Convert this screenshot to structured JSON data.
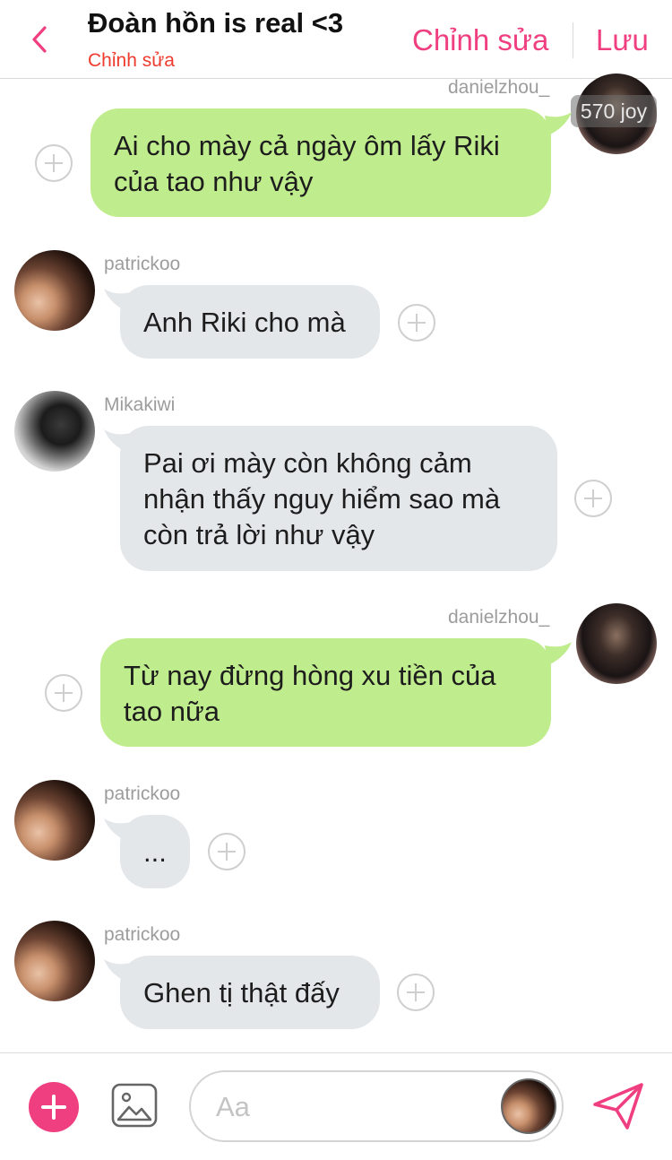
{
  "header": {
    "title": "Đoàn hồn is real <3",
    "subtitle": "Chỉnh sửa",
    "edit_label": "Chỉnh sửa",
    "save_label": "Lưu"
  },
  "messages": [
    {
      "user": "danielzhou_",
      "side": "right",
      "lines": [
        "Ai cho mày cả ngày ôm lấy Riki",
        "của tao như vậy"
      ],
      "badge": "570 joy"
    },
    {
      "user": "patrickoo",
      "side": "left",
      "lines": [
        "Anh Riki cho mà"
      ]
    },
    {
      "user": "Mikakiwi",
      "side": "left",
      "lines": [
        "Pai ơi mày còn không cảm",
        "nhận thấy nguy hiểm sao mà",
        "còn trả lời như vậy"
      ]
    },
    {
      "user": "danielzhou_",
      "side": "right",
      "lines": [
        "Từ nay đừng hòng xu tiền của",
        "tao nữa"
      ]
    },
    {
      "user": "patrickoo",
      "side": "left",
      "lines": [
        "..."
      ]
    },
    {
      "user": "patrickoo",
      "side": "left",
      "lines": [
        "Ghen tị thật đấy"
      ]
    }
  ],
  "composer": {
    "placeholder": "Aa"
  },
  "colors": {
    "accent": "#f03f80",
    "subtitle": "#ee3b2e",
    "bubble_incoming": "#e4e7ea",
    "bubble_outgoing": "#bfec8c"
  },
  "icons": [
    "back-chevron-icon",
    "plus-icon",
    "image-icon",
    "send-icon"
  ]
}
